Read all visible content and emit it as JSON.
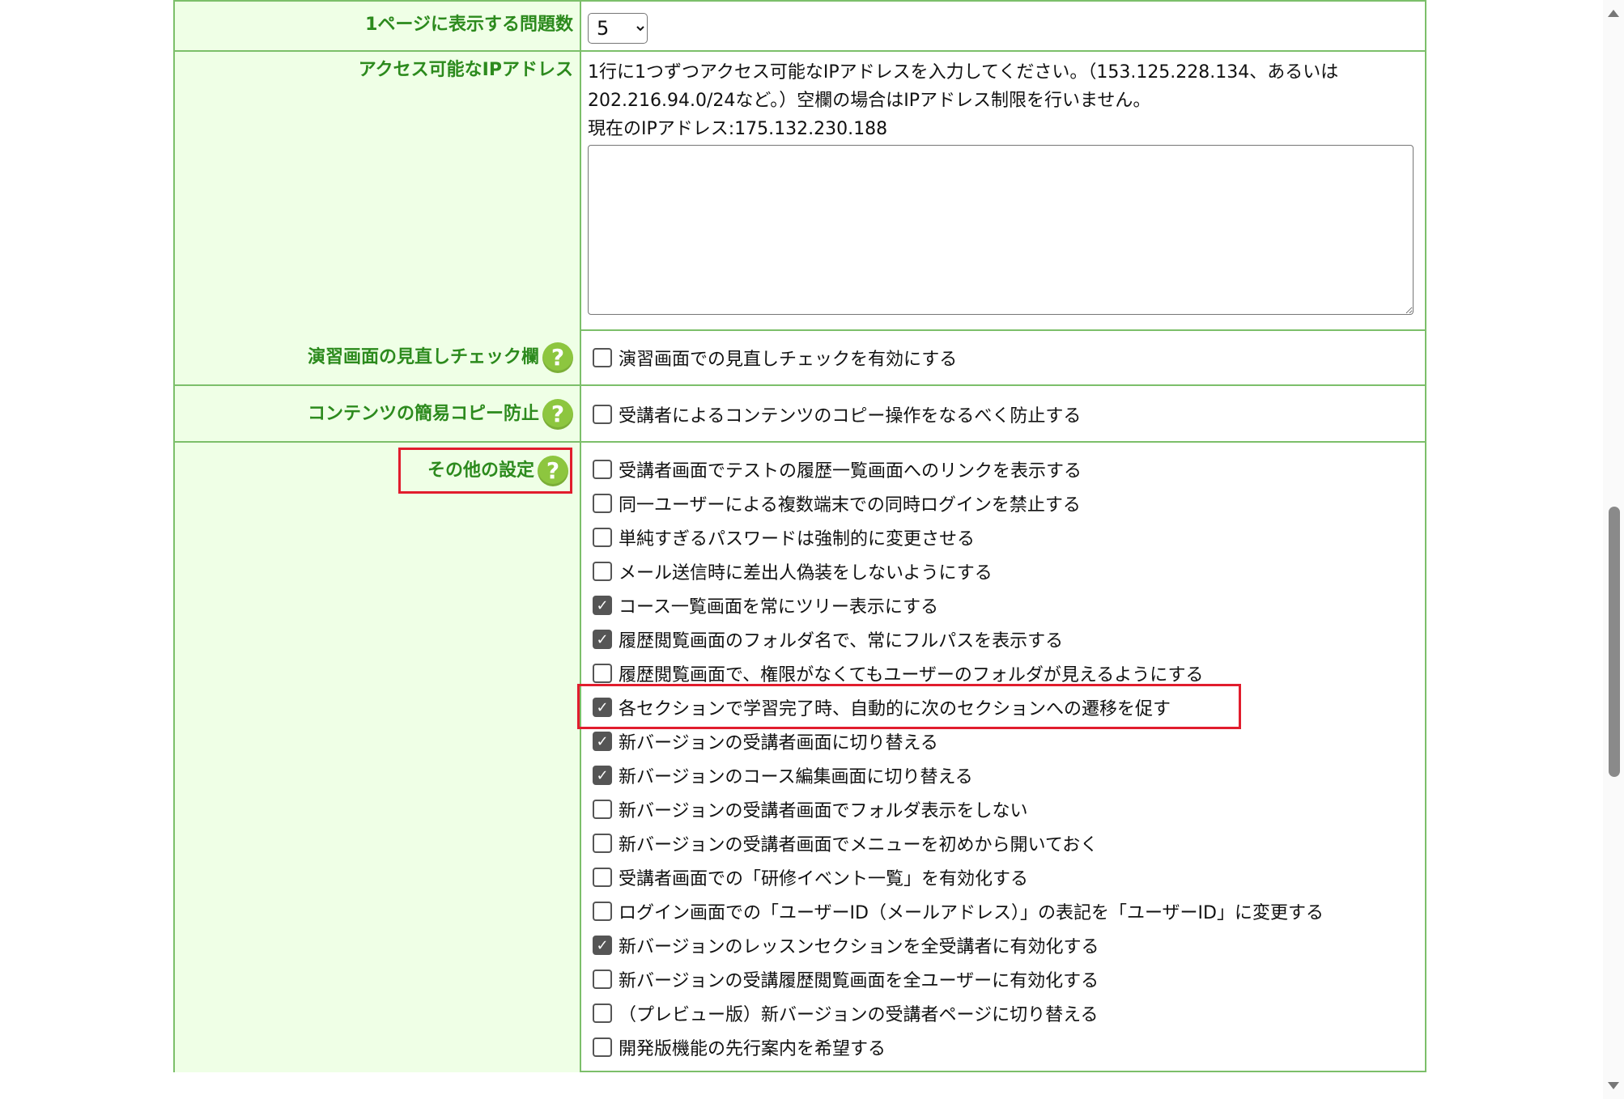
{
  "rows": {
    "per_page": {
      "label": "1ページに表示する問題数",
      "selected": "5"
    },
    "ip": {
      "label": "アクセス可能なIPアドレス",
      "help_line1": "1行に1つずつアクセス可能なIPアドレスを入力してください。（153.125.228.134、あるいは",
      "help_line2": "202.216.94.0/24など。）空欄の場合はIPアドレス制限を行いません。",
      "current_ip": "現在のIPアドレス:175.132.230.188",
      "value": ""
    },
    "review": {
      "label": "演習画面の見直しチェック欄",
      "option": "演習画面での見直しチェックを有効にする",
      "checked": false
    },
    "copy": {
      "label": "コンテンツの簡易コピー防止",
      "option": "受講者によるコンテンツのコピー操作をなるべく防止する",
      "checked": false
    },
    "other": {
      "label": "その他の設定",
      "options": [
        {
          "label": "受講者画面でテストの履歴一覧画面へのリンクを表示する",
          "checked": false
        },
        {
          "label": "同一ユーザーによる複数端末での同時ログインを禁止する",
          "checked": false
        },
        {
          "label": "単純すぎるパスワードは強制的に変更させる",
          "checked": false
        },
        {
          "label": "メール送信時に差出人偽装をしないようにする",
          "checked": false
        },
        {
          "label": "コース一覧画面を常にツリー表示にする",
          "checked": true
        },
        {
          "label": "履歴閲覧画面のフォルダ名で、常にフルパスを表示する",
          "checked": true
        },
        {
          "label": "履歴閲覧画面で、権限がなくてもユーザーのフォルダが見えるようにする",
          "checked": false
        },
        {
          "label": "各セクションで学習完了時、自動的に次のセクションへの遷移を促す",
          "checked": true
        },
        {
          "label": "新バージョンの受講者画面に切り替える",
          "checked": true
        },
        {
          "label": "新バージョンのコース編集画面に切り替える",
          "checked": true
        },
        {
          "label": "新バージョンの受講者画面でフォルダ表示をしない",
          "checked": false
        },
        {
          "label": "新バージョンの受講者画面でメニューを初めから開いておく",
          "checked": false
        },
        {
          "label": "受講者画面での「研修イベント一覧」を有効化する",
          "checked": false
        },
        {
          "label": "ログイン画面での「ユーザーID（メールアドレス）」の表記を「ユーザーID」に変更する",
          "checked": false
        },
        {
          "label": "新バージョンのレッスンセクションを全受講者に有効化する",
          "checked": true
        },
        {
          "label": "新バージョンの受講履歴閲覧画面を全ユーザーに有効化する",
          "checked": false
        },
        {
          "label": "（プレビュー版）新バージョンの受講者ページに切り替える",
          "checked": false
        },
        {
          "label": "開発版機能の先行案内を希望する",
          "checked": false
        }
      ]
    }
  },
  "help_glyph": "?",
  "check_glyph": "✓",
  "colors": {
    "label_text": "#2c8a1d",
    "label_bg": "#efffe6",
    "border": "#7cbf6a",
    "help_icon": "#8dc63f",
    "highlight": "#e11d2d"
  }
}
